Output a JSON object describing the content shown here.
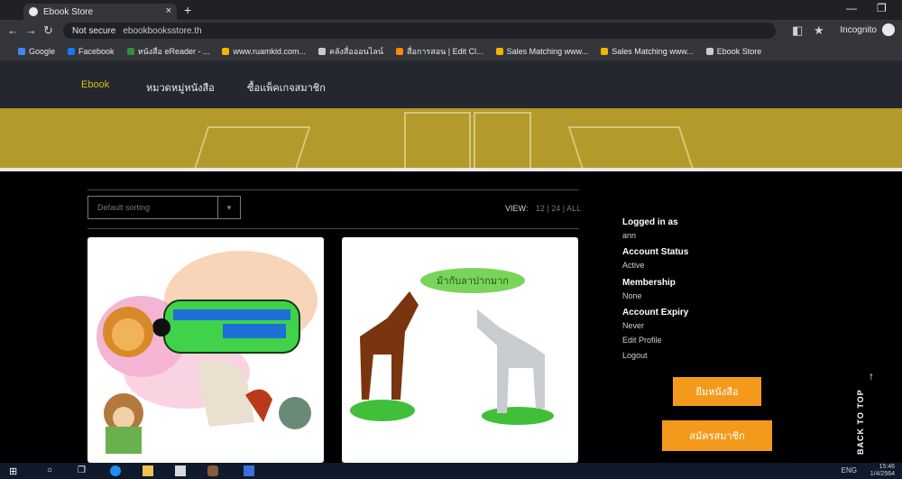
{
  "browser": {
    "tab_title": "Ebook Store",
    "tab_close": "×",
    "new_tab": "+",
    "minimize": "—",
    "maximize": "❐",
    "not_secure": "Not secure",
    "url": "ebookbooksstore.th",
    "incognito_label": "Incognito",
    "bookmarks": [
      {
        "label": "Google",
        "color": "#4285f4"
      },
      {
        "label": "Facebook",
        "color": "#1877f2"
      },
      {
        "label": "หนังสือ eReader - ...",
        "color": "#2f8f3a"
      },
      {
        "label": "www.ruamkid.com...",
        "color": "#f4b400"
      },
      {
        "label": "คลังสื่อออนไลน์",
        "color": "#cccccc"
      },
      {
        "label": "สื่อการสอน | Edit Cl...",
        "color": "#ff8a00"
      },
      {
        "label": "Sales Matching www...",
        "color": "#f4b400"
      },
      {
        "label": "Sales Matching www...",
        "color": "#f4b400"
      },
      {
        "label": "Ebook Store",
        "color": "#cccccc"
      }
    ]
  },
  "site": {
    "nav": [
      "Ebook",
      "หมวดหมู่หนังสือ",
      "ซื้อแพ็คเกจสมาชิก"
    ],
    "accent_color": "#cfc11a",
    "banner_color": "#b39a2a"
  },
  "toolbar": {
    "sort_placeholder": "Default sorting",
    "sort_caret": "▾",
    "view_label": "VIEW:",
    "view_options": "12 | 24 | ALL"
  },
  "books": [
    {
      "title_art": "train-and-animals-cover"
    },
    {
      "title_art": "horse-and-donkey-cover",
      "bubble_text": "ม้ากับลาปากมาก"
    }
  ],
  "account": {
    "logged_in_label": "Logged in as",
    "logged_in_value": "ann",
    "status_label": "Account Status",
    "status_value": "Active",
    "membership_label": "Membership",
    "membership_value": "None",
    "expiry_label": "Account Expiry",
    "expiry_value": "Never",
    "edit_profile": "Edit Profile",
    "logout": "Logout"
  },
  "buttons": {
    "read_books": "ยืมหนังสือ",
    "register": "สมัครสมาชิก",
    "button_color": "#f39a1c"
  },
  "back_to_top": "BACK TO TOP",
  "back_to_top_arrow": "↑",
  "taskbar": {
    "tray_text": "ENG",
    "time": "15:46",
    "date": "1/4/2564"
  }
}
